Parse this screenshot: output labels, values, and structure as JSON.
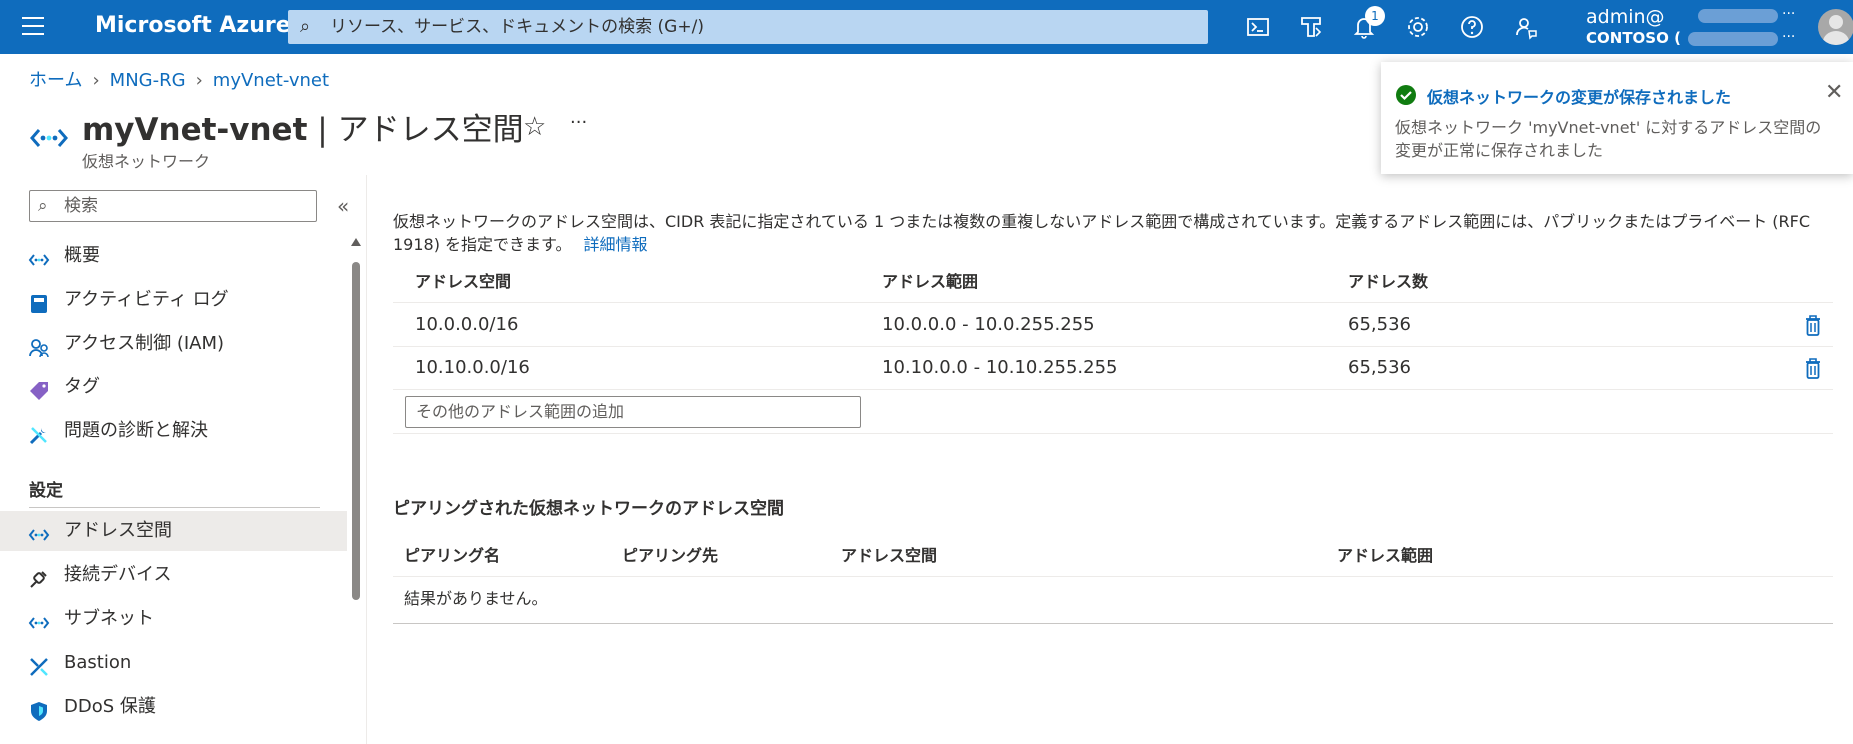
{
  "topbar": {
    "brand": "Microsoft Azure",
    "search_placeholder": "リソース、サービス、ドキュメントの検索 (G+/)",
    "notification_count": "1",
    "account_name": "admin@",
    "account_tenant": "CONTOSO (",
    "more": "···",
    "icons": [
      "cloud-shell-icon",
      "directory-filter-icon",
      "notifications-icon",
      "settings-icon",
      "help-icon",
      "feedback-icon"
    ]
  },
  "breadcrumb": [
    "ホーム",
    "MNG-RG",
    "myVnet-vnet"
  ],
  "header": {
    "resource_name": "myVnet-vnet",
    "separator": "|",
    "page_name": "アドレス空間",
    "subtitle": "仮想ネットワーク",
    "star": "☆",
    "more": "···"
  },
  "sidebar": {
    "search_placeholder": "検索",
    "collapse": "«",
    "items": [
      {
        "label": "概要",
        "icon": "vnet-icon"
      },
      {
        "label": "アクティビティ ログ",
        "icon": "activity-log-icon"
      },
      {
        "label": "アクセス制御 (IAM)",
        "icon": "iam-icon"
      },
      {
        "label": "タグ",
        "icon": "tag-icon"
      },
      {
        "label": "問題の診断と解決",
        "icon": "diagnose-icon"
      }
    ],
    "section": "設定",
    "settings_items": [
      {
        "label": "アドレス空間",
        "icon": "vnet-icon",
        "active": true
      },
      {
        "label": "接続デバイス",
        "icon": "plug-icon"
      },
      {
        "label": "サブネット",
        "icon": "vnet-icon"
      },
      {
        "label": "Bastion",
        "icon": "bastion-icon"
      },
      {
        "label": "DDoS 保護",
        "icon": "shield-icon"
      }
    ]
  },
  "main": {
    "description": "仮想ネットワークのアドレス空間は、CIDR 表記に指定されている 1 つまたは複数の重複しないアドレス範囲で構成されています。定義するアドレス範囲には、パブリックまたはプライベート (RFC 1918) を指定できます。",
    "learn_more": "詳細情報",
    "address_table": {
      "headers": [
        "アドレス空間",
        "アドレス範囲",
        "アドレス数"
      ],
      "rows": [
        [
          "10.0.0.0/16",
          "10.0.0.0 - 10.0.255.255",
          "65,536"
        ],
        [
          "10.10.0.0/16",
          "10.10.0.0 - 10.10.255.255",
          "65,536"
        ]
      ]
    },
    "add_placeholder": "その他のアドレス範囲の追加",
    "peering_section_title": "ピアリングされた仮想ネットワークのアドレス空間",
    "peering_table": {
      "headers": [
        "ピアリング名",
        "ピアリング先",
        "アドレス空間",
        "アドレス範囲"
      ],
      "empty": "結果がありません。"
    }
  },
  "toast": {
    "title": "仮想ネットワークの変更が保存されました",
    "body": "仮想ネットワーク 'myVnet-vnet' に対するアドレス空間の変更が正常に保存されました",
    "close": "✕"
  },
  "colors": {
    "accent": "#0f6cbd",
    "success": "#107c10",
    "active_bg": "#edebe9"
  }
}
